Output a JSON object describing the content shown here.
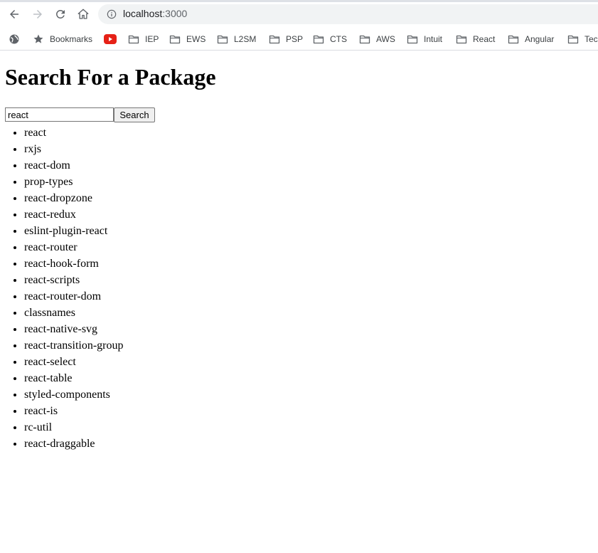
{
  "browser": {
    "url_host": "localhost",
    "url_port": ":3000",
    "bookmarks": [
      {
        "label": "Bookmarks",
        "icon": "star-icon"
      },
      {
        "label": "",
        "icon": "youtube-icon"
      },
      {
        "label": "IEP",
        "icon": "folder-icon"
      },
      {
        "label": "EWS",
        "icon": "folder-icon"
      },
      {
        "label": "L2SM",
        "icon": "folder-icon"
      },
      {
        "label": "PSP",
        "icon": "folder-icon"
      },
      {
        "label": "CTS",
        "icon": "folder-icon"
      },
      {
        "label": "AWS",
        "icon": "folder-icon"
      },
      {
        "label": "Intuit",
        "icon": "folder-icon"
      },
      {
        "label": "React",
        "icon": "folder-icon"
      },
      {
        "label": "Angular",
        "icon": "folder-icon"
      },
      {
        "label": "Tec",
        "icon": "folder-icon"
      }
    ]
  },
  "page": {
    "title": "Search For a Package",
    "search_value": "react",
    "search_button_label": "Search",
    "results": [
      "react",
      "rxjs",
      "react-dom",
      "prop-types",
      "react-dropzone",
      "react-redux",
      "eslint-plugin-react",
      "react-router",
      "react-hook-form",
      "react-scripts",
      "react-router-dom",
      "classnames",
      "react-native-svg",
      "react-transition-group",
      "react-select",
      "react-table",
      "styled-components",
      "react-is",
      "rc-util",
      "react-draggable"
    ]
  }
}
